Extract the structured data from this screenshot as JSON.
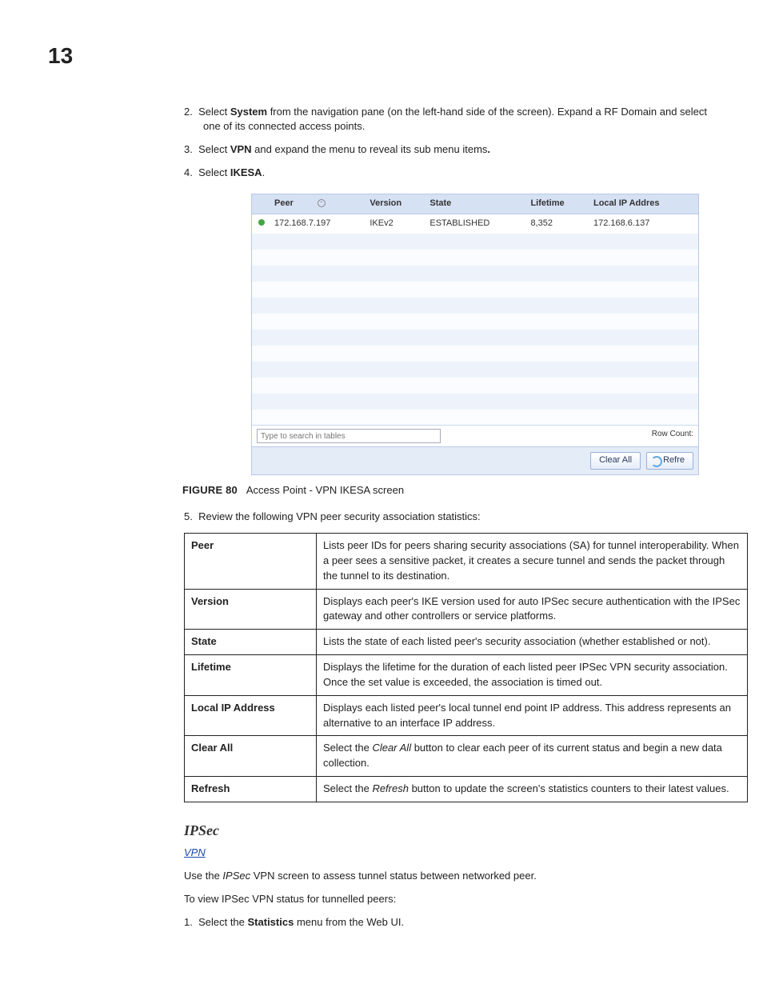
{
  "page_number": "13",
  "steps_upper": [
    {
      "num": "2.",
      "html_parts": [
        "Select ",
        {
          "b": "System"
        },
        " from the navigation pane (on the left-hand side of the screen). Expand a RF Domain and select one of its connected access points."
      ]
    },
    {
      "num": "3.",
      "html_parts": [
        "Select ",
        {
          "b": "VPN"
        },
        " and expand the menu to reveal its sub menu items",
        {
          "b": "."
        }
      ]
    },
    {
      "num": "4.",
      "html_parts": [
        "Select ",
        {
          "b": "IKESA"
        },
        "."
      ]
    }
  ],
  "ikesa_table": {
    "headers": [
      "",
      "Peer",
      "Version",
      "State",
      "Lifetime",
      "Local IP Addres"
    ],
    "rows": [
      {
        "peer": "172.168.7.197",
        "version": "IKEv2",
        "state": "ESTABLISHED",
        "lifetime": "8,352",
        "local_ip": "172.168.6.137"
      }
    ],
    "blank_rows": 12,
    "search_placeholder": "Type to search in tables",
    "row_count_label": "Row Count:",
    "buttons": {
      "clear_all": "Clear All",
      "refresh": "Refre"
    }
  },
  "figure": {
    "label": "FIGURE 80",
    "caption": "Access Point - VPN IKESA screen"
  },
  "step5": {
    "num": "5.",
    "text": "Review the following VPN peer security association statistics:"
  },
  "desc_rows": [
    {
      "k": "Peer",
      "v": "Lists peer IDs for peers sharing security associations (SA) for tunnel interoperability. When a peer sees a sensitive packet, it creates a secure tunnel and sends the packet through the tunnel to its destination."
    },
    {
      "k": "Version",
      "v": "Displays each peer's IKE version used for auto IPSec secure authentication with the IPSec gateway and other controllers or service platforms."
    },
    {
      "k": "State",
      "v": "Lists the state of each listed peer's security association (whether established or not)."
    },
    {
      "k": "Lifetime",
      "v": "Displays the lifetime for the duration of each listed peer IPSec VPN security association. Once the set value is exceeded, the association is timed out."
    },
    {
      "k": "Local IP Address",
      "v": "Displays each listed peer's local tunnel end point IP address. This address represents an alternative to an interface IP address."
    },
    {
      "k": "Clear All",
      "v_parts": [
        "Select the ",
        {
          "i": "Clear All"
        },
        " button to clear each peer of its current status and begin a new data collection."
      ]
    },
    {
      "k": "Refresh",
      "v_parts": [
        "Select the ",
        {
          "i": "Refresh"
        },
        " button to update the screen's statistics counters to their latest values."
      ]
    }
  ],
  "ipsec": {
    "heading": "IPSec",
    "link": "VPN",
    "para1_parts": [
      "Use the ",
      {
        "i": "IPSec"
      },
      " VPN screen to assess tunnel status between networked peer."
    ],
    "para2": "To view IPSec VPN status for tunnelled peers:",
    "step1": {
      "num": "1.",
      "html_parts": [
        "Select the ",
        {
          "b": "Statistics"
        },
        " menu from the Web UI."
      ]
    }
  }
}
